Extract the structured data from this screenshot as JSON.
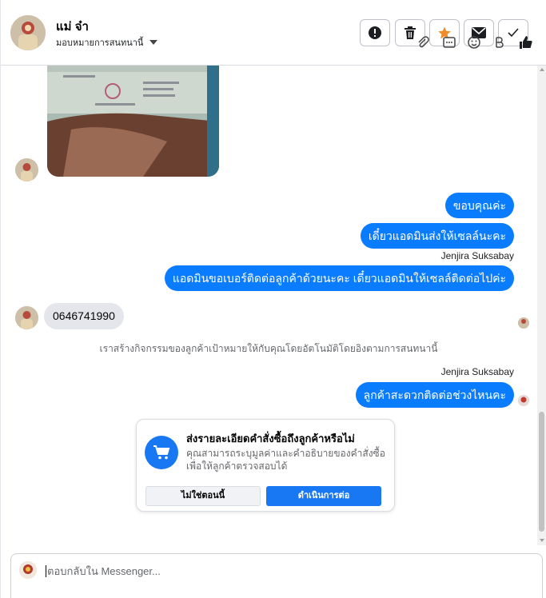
{
  "header": {
    "contact_name": "แม่ จ๋า",
    "assign_label": "มอบหมายการสนทนานี้",
    "actions": [
      {
        "name": "report-button",
        "icon": "alert-icon"
      },
      {
        "name": "delete-button",
        "icon": "trash-icon"
      },
      {
        "name": "star-button",
        "icon": "star-icon"
      },
      {
        "name": "mark-unread-button",
        "icon": "envelope-icon"
      },
      {
        "name": "mark-done-button",
        "icon": "checkmark-icon"
      }
    ]
  },
  "messages": {
    "out_1": "ขอบคุณค่ะ",
    "out_2": "เดี๋ยวแอดมินส่งให้เซลล์นะคะ",
    "sender_1": "Jenjira Suksabay",
    "out_3": "แอดมินขอเบอร์ติดต่อลูกค้าด้วยนะคะ เดี๋ยวแอดมินให้เซลล์ติดต่อไปค่ะ",
    "in_phone": "0646741990",
    "system_note": "เราสร้างกิจกรรมของลูกค้าเป้าหมายให้กับคุณโดยอัตโนมัติโดยอิงตามการสนทนานี้",
    "sender_2": "Jenjira Suksabay",
    "out_4": "ลูกค้าสะดวกติดต่อช่วงไหนคะ"
  },
  "order_card": {
    "title": "ส่งรายละเอียดคำสั่งซื้อถึงลูกค้าหรือไม่",
    "body": "คุณสามารถระบุมูลค่าและคำอธิบายของคำสั่งซื้อเพื่อให้ลูกค้าตรวจสอบได้",
    "decline_label": "ไม่ใช่ตอนนี้",
    "continue_label": "ดำเนินการต่อ",
    "icon": "shopping-cart-icon"
  },
  "composer": {
    "placeholder": "ตอบกลับใน Messenger...",
    "tools": [
      "paperclip-icon",
      "saved-reply-icon",
      "emoji-icon",
      "payment-icon",
      "thumbs-up-icon"
    ]
  },
  "colors": {
    "accent": "#1877f2",
    "outgoing_bubble": "#0a7cff",
    "incoming_bubble": "#e4e6eb",
    "star": "#f28c28"
  }
}
